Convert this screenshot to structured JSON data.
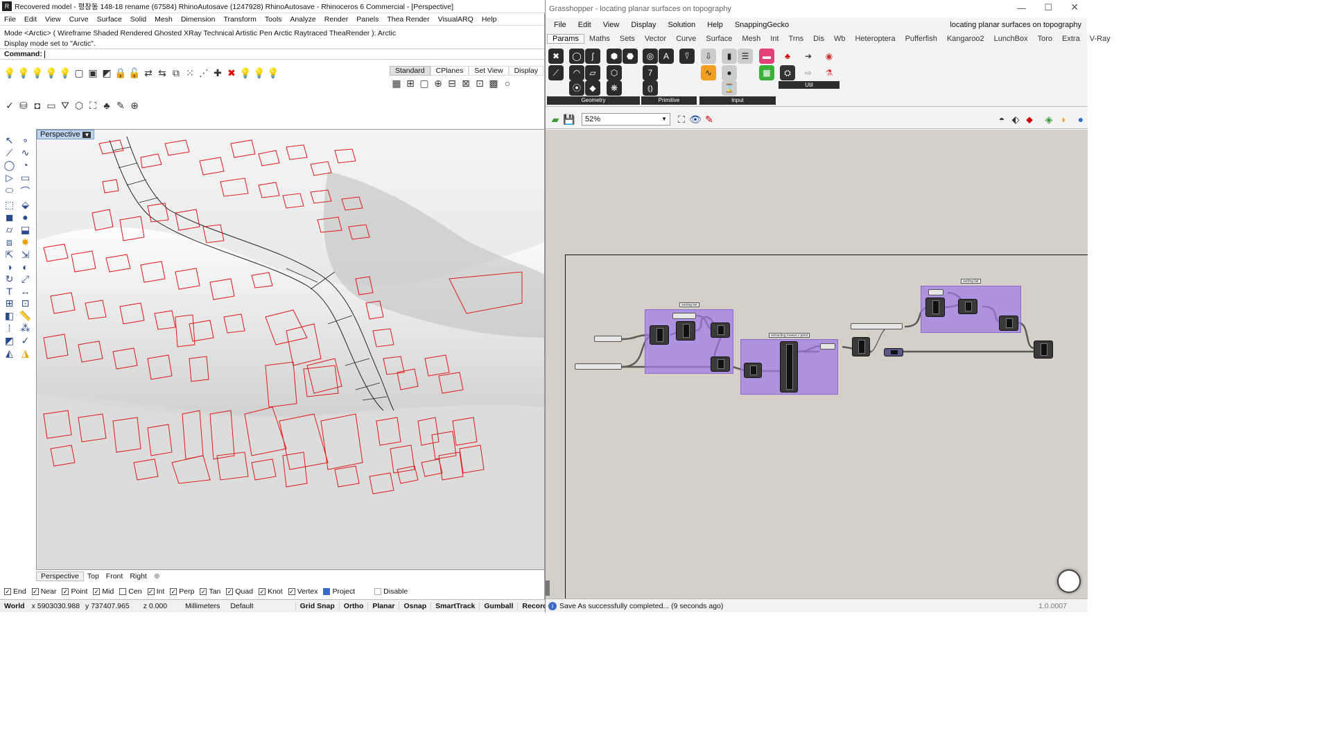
{
  "rhino": {
    "title": "Recovered model - 평창동 148-18 rename (67584) RhinoAutosave (1247928) RhinoAutosave - Rhinoceros 6 Commercial - [Perspective]",
    "menu": [
      "File",
      "Edit",
      "View",
      "Curve",
      "Surface",
      "Solid",
      "Mesh",
      "Dimension",
      "Transform",
      "Tools",
      "Analyze",
      "Render",
      "Panels",
      "Thea Render",
      "VisualARQ",
      "Help"
    ],
    "history_line1": "Mode <Arctic> ( Wireframe  Shaded  Rendered  Ghosted  XRay  Technical  Artistic  Pen  Arctic  Raytraced  TheaRender ): Arctic",
    "history_line2": "Display mode set to \"Arctic\".",
    "command_label": "Command:",
    "toolbar_tabs": [
      "Standard",
      "CPlanes",
      "Set View",
      "Display"
    ],
    "viewport_label": "Perspective",
    "viewport_tabs": [
      "Perspective",
      "Top",
      "Front",
      "Right"
    ],
    "osnaps": [
      {
        "label": "End",
        "checked": true
      },
      {
        "label": "Near",
        "checked": true
      },
      {
        "label": "Point",
        "checked": true
      },
      {
        "label": "Mid",
        "checked": true
      },
      {
        "label": "Cen",
        "checked": false
      },
      {
        "label": "Int",
        "checked": true
      },
      {
        "label": "Perp",
        "checked": true
      },
      {
        "label": "Tan",
        "checked": true
      },
      {
        "label": "Quad",
        "checked": true
      },
      {
        "label": "Knot",
        "checked": true
      },
      {
        "label": "Vertex",
        "checked": true
      },
      {
        "label": "Project",
        "checked": true
      },
      {
        "label": "Disable",
        "checked": false
      }
    ],
    "status": {
      "cplane": "World",
      "x": "x 5903030.988",
      "y": "y 737407.965",
      "z": "z 0.000",
      "units": "Millimeters",
      "layer": "Default",
      "modes": [
        "Grid Snap",
        "Ortho",
        "Planar",
        "Osnap",
        "SmartTrack",
        "Gumball",
        "Record"
      ]
    }
  },
  "grasshopper": {
    "title": "Grasshopper - locating planar surfaces on topography",
    "menu": [
      "File",
      "Edit",
      "View",
      "Display",
      "Solution",
      "Help",
      "SnappingGecko"
    ],
    "doc_name": "locating planar surfaces on topography",
    "tabs": [
      "Params",
      "Maths",
      "Sets",
      "Vector",
      "Curve",
      "Surface",
      "Mesh",
      "Int",
      "Trns",
      "Dis",
      "Wb",
      "Heteroptera",
      "Pufferfish",
      "Kangaroo2",
      "LunchBox",
      "Toro",
      "Extra",
      "V-Ray"
    ],
    "panel_groups": [
      "Geometry",
      "Primitive",
      "Input",
      "Util"
    ],
    "zoom": "52%",
    "group_labels": [
      "sorting list",
      "extracting lowest z point",
      "sorting list"
    ],
    "status_message": "Save As successfully completed... (9 seconds ago)",
    "version": "1.0.0007"
  }
}
